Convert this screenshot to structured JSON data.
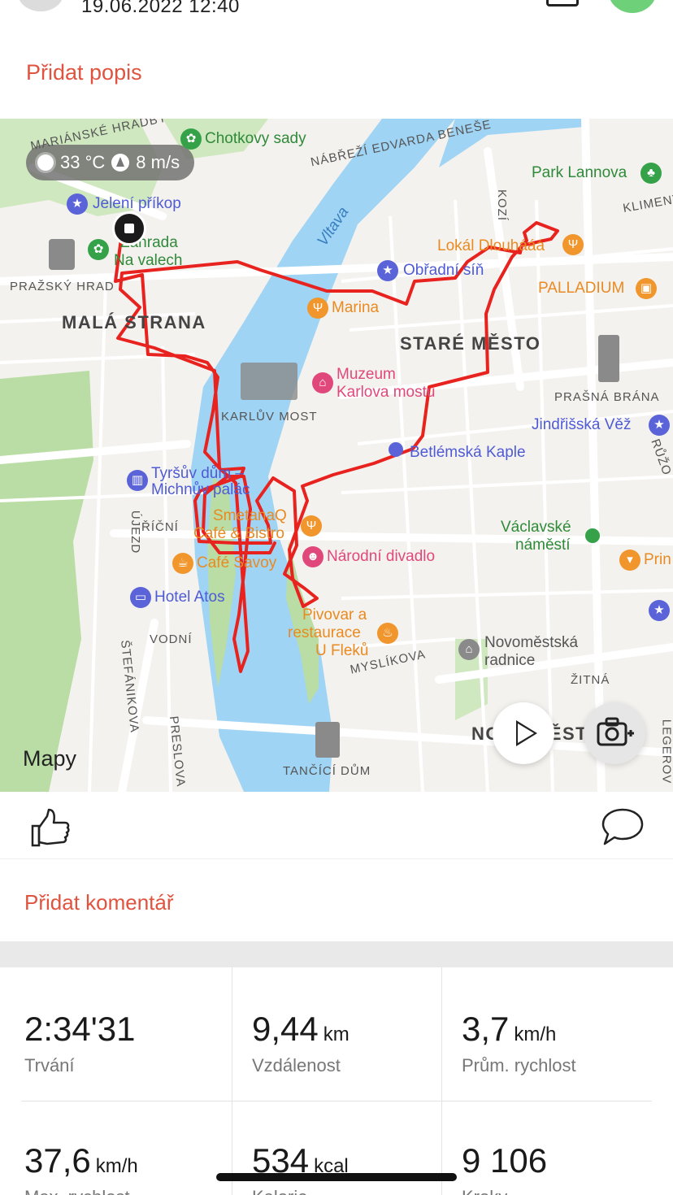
{
  "header": {
    "date": "19.06.2022 12:40",
    "add_description": "Přidat popis"
  },
  "map": {
    "weather": {
      "temperature": "33 °C",
      "wind": "8 m/s"
    },
    "attribution": "Mapy",
    "labels": {
      "chotkovy": "Chotkovy sady",
      "nabrezi": "NÁBŘEŽÍ EDVARDA BENEŠE",
      "hradby": "MARIÁNSKÉ HRADBY",
      "park_lannova": "Park Lannova",
      "klimentska": "KLIMENT",
      "jeleni": "Jelení příkop",
      "zahrada_1": "Zahrada",
      "zahrada_2": "Na valech",
      "prazsky_hrad": "PRAŽSKÝ HRAD",
      "vltava": "Vltava",
      "kozi": "KOZÍ",
      "lokal": "Lokál Dlouhááá",
      "obradni": "Obřadní síň",
      "palladium": "PALLADIUM",
      "mala_strana": "MALÁ STRANA",
      "marina": "Marina",
      "stare_mesto": "STARÉ MĚSTO",
      "muzeum_1": "Muzeum",
      "muzeum_2": "Karlova mostu",
      "karluv_most": "KARLŮV MOST",
      "prasna_brana": "PRAŠNÁ BRÁNA",
      "jindrisska": "Jindřišská Věž",
      "betlemska": "Betlémská Kaple",
      "ruzova": "RŮŽO",
      "tyrsuv_1": "Tyršův dům –",
      "tyrsuv_2": "Michnův palác",
      "ujezd": "ÚJEZD",
      "ricni": "ŘÍČNÍ",
      "smetana_1": "SmetanaQ",
      "smetana_2": "Café & Bistro",
      "vaclavske_1": "Václavské",
      "vaclavske_2": "náměstí",
      "narodni": "Národní divadlo",
      "cafe_savoy": "Café Savoy",
      "prin": "Prin",
      "hotel_atos": "Hotel Atos",
      "pivovar_1": "Pivovar a",
      "pivovar_2": "restaurace",
      "pivovar_3": "U Fleků",
      "vodni": "VODNÍ",
      "novomestska_1": "Novoměstská",
      "novomestska_2": "radnice",
      "myslikova": "MYSLÍKOVA",
      "stefanikova": "ŠTEFÁNIKOVA",
      "zitna": "ŽITNÁ",
      "nove_mesto": "NOVÉ MĚSTO",
      "legerova": "LEGEROV",
      "preslova": "PRESLOVA",
      "tancici": "TANČÍCÍ DŮM"
    },
    "colors": {
      "route": "#e8231f",
      "water": "#9fd4f5",
      "park": "#b7dfa2",
      "road": "#ffffff"
    }
  },
  "actions": {
    "like_icon": "thumbs-up-icon",
    "comment_icon": "speech-bubble-icon"
  },
  "comment": {
    "add_comment": "Přidat komentář"
  },
  "stats": [
    {
      "value": "2:34'31",
      "unit": "",
      "label": "Trvání"
    },
    {
      "value": "9,44",
      "unit": "km",
      "label": "Vzdálenost"
    },
    {
      "value": "3,7",
      "unit": "km/h",
      "label": "Prům. rychlost"
    },
    {
      "value": "37,6",
      "unit": "km/h",
      "label": "Max. rychlost"
    },
    {
      "value": "534",
      "unit": "kcal",
      "label": "Kalorie"
    },
    {
      "value": "9 106",
      "unit": "",
      "label": "Kroky"
    }
  ]
}
